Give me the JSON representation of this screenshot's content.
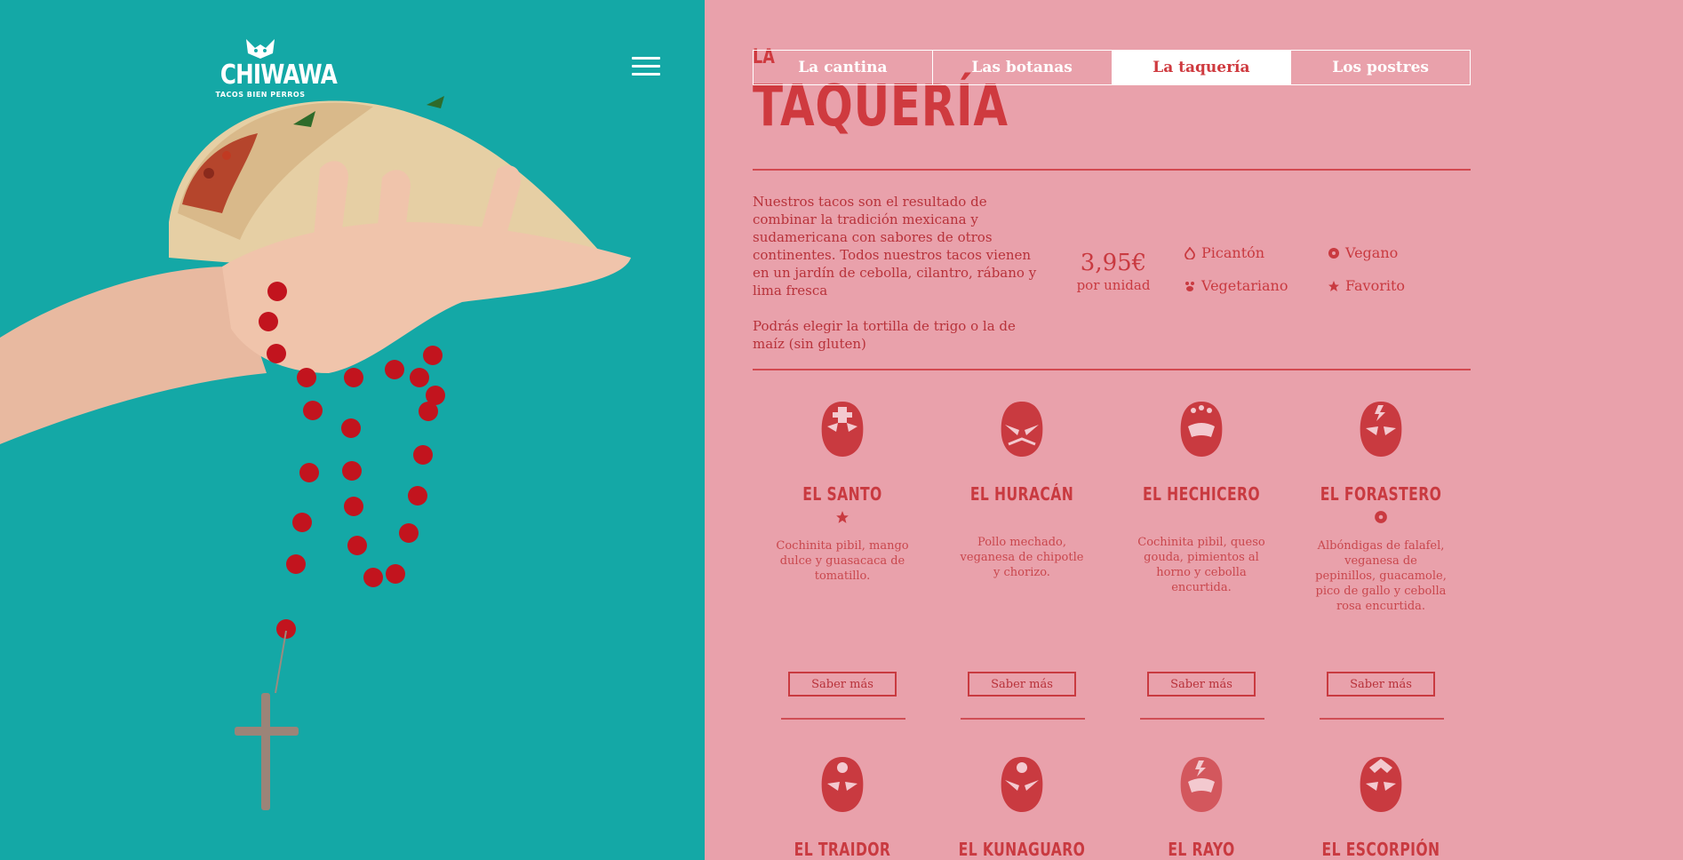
{
  "brand": {
    "name": "CHIWAWA",
    "tagline": "TACOS BIEN PERROS"
  },
  "colors": {
    "teal": "#14a8a6",
    "pink": "#e9a1ab",
    "red": "#cf3a3f"
  },
  "nav": {
    "tabs": [
      {
        "label": "La cantina",
        "active": false
      },
      {
        "label": "Las botanas",
        "active": false
      },
      {
        "label": "La taquería",
        "active": true
      },
      {
        "label": "Los postres",
        "active": false
      }
    ]
  },
  "page": {
    "title_small": "LA",
    "title": "TAQUERÍA"
  },
  "intro": {
    "paragraph1": "Nuestros tacos son el resultado de combinar la tradición mexicana y sudamericana con sabores de otros continentes. Todos nuestros tacos vienen en un jardín de cebolla, cilantro, rábano y lima fresca",
    "paragraph2": "Podrás elegir la tortilla de trigo o la de maíz (sin gluten)"
  },
  "price": {
    "value": "3,95€",
    "unit": "por unidad"
  },
  "legend": [
    {
      "label": "Picantón",
      "icon": "flame-icon"
    },
    {
      "label": "Vegano",
      "icon": "flower-icon"
    },
    {
      "label": "Vegetariano",
      "icon": "paw-icon"
    },
    {
      "label": "Favorito",
      "icon": "star-icon"
    }
  ],
  "tacos": [
    {
      "name": "EL SANTO",
      "tag": "star-icon",
      "description": "Cochinita pibil, mango dulce y guasacaca de tomatillo.",
      "button": "Saber más"
    },
    {
      "name": "EL HURACÁN",
      "tag": "",
      "description": "Pollo mechado, veganesa de chipotle y chorizo.",
      "button": "Saber más"
    },
    {
      "name": "EL HECHICERO",
      "tag": "",
      "description": "Cochinita pibil, queso gouda, pimientos al horno y cebolla encurtida.",
      "button": "Saber más"
    },
    {
      "name": "EL FORASTERO",
      "tag": "flower-icon",
      "description": "Albóndigas de falafel, veganesa de pepinillos, guacamole, pico de gallo y cebolla rosa encurtida.",
      "button": "Saber más"
    }
  ],
  "tacos_row2": [
    {
      "name": "EL TRAIDOR"
    },
    {
      "name": "EL KUNAGUARO"
    },
    {
      "name": "EL RAYO"
    },
    {
      "name": "EL ESCORPIÓN"
    }
  ]
}
